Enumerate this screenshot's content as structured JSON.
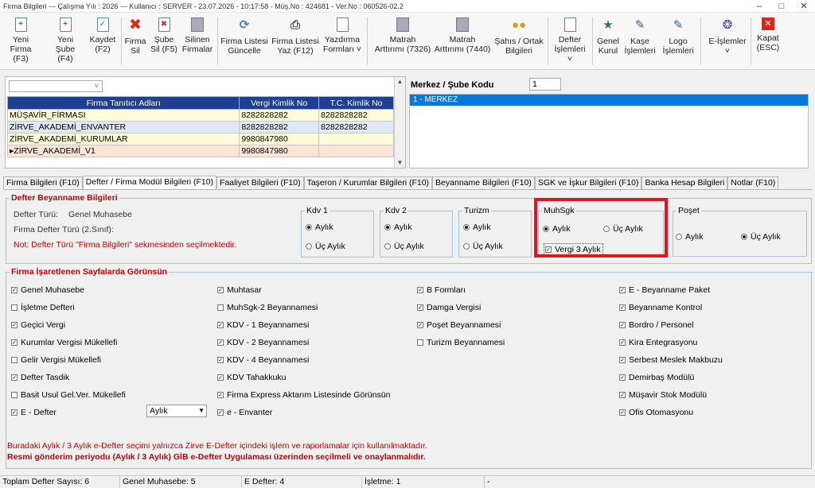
{
  "window": {
    "title": "Firma Bilgileri  ---  Çalışma Yılı : 2026   ---   Kullanıcı : SERVER  -  23.07.2026  -  10:17:58  -  Müş.No : 424681  -  Ver.No : 060526-02.2"
  },
  "toolbar": {
    "buttons": [
      {
        "label1": "Yeni",
        "label2": "Firma (F3)",
        "icon": "new-firm-icon"
      },
      {
        "label1": "Yeni",
        "label2": "Şube (F4)",
        "icon": "new-branch-icon"
      },
      {
        "label1": "Kaydet",
        "label2": "(F2)",
        "icon": "save-icon"
      },
      {
        "label1": "Firma",
        "label2": "Sil",
        "icon": "delete-firm-icon"
      },
      {
        "label1": "Şube",
        "label2": "Sil (F5)",
        "icon": "delete-branch-icon"
      },
      {
        "label1": "Silinen",
        "label2": "Firmalar",
        "icon": "deleted-firms-icon"
      },
      {
        "label1": "Firma Listesi",
        "label2": "Güncelle",
        "icon": "refresh-list-icon"
      },
      {
        "label1": "Firma Listesi",
        "label2": "Yaz (F12)",
        "icon": "print-list-icon"
      },
      {
        "label1": "Yazdırma",
        "label2": "Formları ˅",
        "icon": "print-forms-icon"
      },
      {
        "label1": "Matrah",
        "label2": "Arttırımı (7326)",
        "icon": "base-increase-icon"
      },
      {
        "label1": "Matrah",
        "label2": "Arttırımı (7440)",
        "icon": "base-increase-icon"
      },
      {
        "label1": "Şahıs / Ortak",
        "label2": "Bilgileri",
        "icon": "partners-icon"
      },
      {
        "label1": "Defter",
        "label2": "İşlemleri ˅",
        "icon": "ledger-icon"
      },
      {
        "label1": "Genel",
        "label2": "Kurul",
        "icon": "general-assembly-icon"
      },
      {
        "label1": "Kaşe",
        "label2": "İşlemleri",
        "icon": "stamp-icon"
      },
      {
        "label1": "Logo",
        "label2": "İşlemleri",
        "icon": "logo-icon"
      },
      {
        "label1": "E-İşlemler",
        "label2": "˅",
        "icon": "e-operations-icon"
      },
      {
        "label1": "Kapat",
        "label2": "(ESC)",
        "icon": "close-icon"
      }
    ]
  },
  "firm_grid": {
    "headers": [
      "Firma Tanıtıcı Adları",
      "Vergi Kimlik No",
      "T.C. Kimlik No"
    ],
    "rows": [
      {
        "name": "MÜŞAVİR_FİRMASI",
        "vkn": "8282828282",
        "tckn": "8282828282"
      },
      {
        "name": "ZİRVE_AKADEMİ_ENVANTER",
        "vkn": "8282828282",
        "tckn": "8282828282"
      },
      {
        "name": "ZİRVE_AKADEMİ_KURUMLAR",
        "vkn": "9980847980",
        "tckn": ""
      },
      {
        "name": "ZİRVE_AKADEMİ_V1",
        "vkn": "9980847980",
        "tckn": ""
      }
    ]
  },
  "branch": {
    "label": "Merkez / Şube Kodu",
    "code": "1",
    "selected_item": "1 - MERKEZ"
  },
  "tabs": [
    "Firma Bilgileri (F10)",
    "Defter / Firma Modül Bilgileri (F10)",
    "Faaliyet Bilgileri (F10)",
    "Taşeron / Kurumlar Bilgileri (F10)",
    "Beyanname Bilgileri (F10)",
    "SGK ve İşkur Bilgileri (F10)",
    "Banka Hesap Bilgileri",
    "Notlar (F10)"
  ],
  "defter": {
    "title": "Defter Beyanname Bilgileri",
    "type_label": "Defter Türü:",
    "type_value": "Genel Muhasebe",
    "firm_type_label": "Firma Defter Türü (2.Sınıf):",
    "note": "Not: Defter Türü \"Firma Bilgileri\" sekmesinden seçilmektedir.",
    "kdv1": {
      "title": "Kdv 1",
      "opt1": "Aylık",
      "opt2": "Üç Aylık"
    },
    "kdv2": {
      "title": "Kdv 2",
      "opt1": "Aylık",
      "opt2": "Üç Aylık"
    },
    "turizm": {
      "title": "Turizm",
      "opt1": "Aylık",
      "opt2": "Üç Aylık"
    },
    "muhsgk": {
      "title": "MuhSgk",
      "opt1": "Aylık",
      "opt2": "Üç Aylık",
      "check": "Vergi 3 Aylık"
    },
    "poset": {
      "title": "Poşet",
      "opt1": "Aylık",
      "opt2": "Üç Aylık"
    }
  },
  "pages": {
    "title": "Firma İşaretlenen Sayfalarda Görünsün",
    "col1": [
      {
        "label": "Genel Muhasebe",
        "checked": true
      },
      {
        "label": "İşletme Defteri",
        "checked": false
      },
      {
        "label": "Geçici Vergi",
        "checked": true
      },
      {
        "label": "Kurumlar Vergisi Mükellefi",
        "checked": true
      },
      {
        "label": "Gelir Vergisi Mükellefi",
        "checked": false
      },
      {
        "label": "Defter Tasdik",
        "checked": true
      },
      {
        "label": "Basit Usul Gel.Ver. Mükellefi",
        "checked": false
      },
      {
        "label": "E - Defter",
        "checked": true
      }
    ],
    "col2": [
      {
        "label": "Muhtasar",
        "checked": true
      },
      {
        "label": "MuhSgk-2 Beyannamesi",
        "checked": false
      },
      {
        "label": "KDV - 1 Beyannamesi",
        "checked": true
      },
      {
        "label": "KDV - 2 Beyannamesi",
        "checked": true
      },
      {
        "label": "KDV - 4 Beyannamesi",
        "checked": true
      },
      {
        "label": "KDV Tahakkuku",
        "checked": true
      },
      {
        "label": "Firma Express Aktarım Listesinde Görünsün",
        "checked": true
      },
      {
        "label": "e - Envanter",
        "checked": true
      }
    ],
    "col3": [
      {
        "label": "B Formları",
        "checked": true
      },
      {
        "label": "Damga Vergisi",
        "checked": true
      },
      {
        "label": "Poşet Beyannamesi",
        "checked": true
      },
      {
        "label": "Turizm Beyannamesi",
        "checked": false
      }
    ],
    "col4": [
      {
        "label": "E - Beyanname Paket",
        "checked": true
      },
      {
        "label": "Beyanname Kontrol",
        "checked": true
      },
      {
        "label": "Bordro / Personel",
        "checked": true
      },
      {
        "label": "Kira Entegrasyonu",
        "checked": true
      },
      {
        "label": "Serbest Meslek Makbuzu",
        "checked": true
      },
      {
        "label": "Demirbaş Modülü",
        "checked": true
      },
      {
        "label": "Müşavir Stok Modülü",
        "checked": true
      },
      {
        "label": "Ofis Otomasyonu",
        "checked": true
      }
    ],
    "edefter_period": "Aylık",
    "note1": "Buradaki Aylık / 3 Aylık e-Defter seçimi yalnızca Zirve E-Defter içindeki işlem ve raporlamalar için kullanılmaktadır.",
    "note2": "Resmi gönderim periyodu (Aylık / 3 Aylık) GİB e-Defter Uygulaması üzerinden seçilmeli ve onaylanmalıdır."
  },
  "status": {
    "total": "Toplam Defter Sayısı: 6",
    "general": "Genel Muhasebe: 5",
    "edefter": "E Defter: 4",
    "isletme": "İşletme: 1",
    "dash": "-"
  },
  "colors": {
    "highlight": "#e0161e",
    "grid_header": "#1f3f93",
    "selection": "#0a78d7",
    "warning_text": "#c00000"
  }
}
